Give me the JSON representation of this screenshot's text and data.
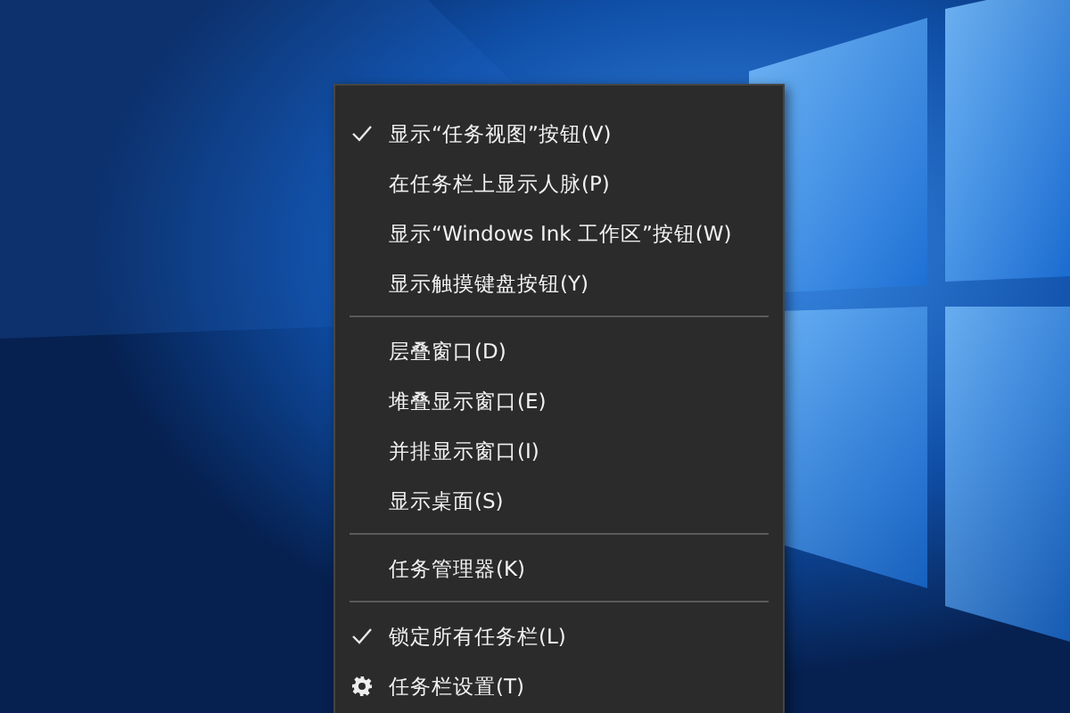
{
  "context_menu": {
    "sections": [
      {
        "items": [
          {
            "kind": "option",
            "label": "显示“任务视图”按钮(V)",
            "checked": true
          },
          {
            "kind": "option",
            "label": "在任务栏上显示人脉(P)",
            "checked": false
          },
          {
            "kind": "option",
            "label": "显示“Windows Ink 工作区”按钮(W)",
            "checked": false
          },
          {
            "kind": "option",
            "label": "显示触摸键盘按钮(Y)",
            "checked": false
          }
        ]
      },
      {
        "items": [
          {
            "kind": "option",
            "label": "层叠窗口(D)",
            "checked": false
          },
          {
            "kind": "option",
            "label": "堆叠显示窗口(E)",
            "checked": false
          },
          {
            "kind": "option",
            "label": "并排显示窗口(I)",
            "checked": false
          },
          {
            "kind": "option",
            "label": "显示桌面(S)",
            "checked": false
          }
        ]
      },
      {
        "items": [
          {
            "kind": "option",
            "label": "任务管理器(K)",
            "checked": false
          }
        ]
      },
      {
        "items": [
          {
            "kind": "option",
            "label": "锁定所有任务栏(L)",
            "checked": true
          },
          {
            "kind": "settings",
            "label": "任务栏设置(T)"
          }
        ]
      }
    ]
  }
}
